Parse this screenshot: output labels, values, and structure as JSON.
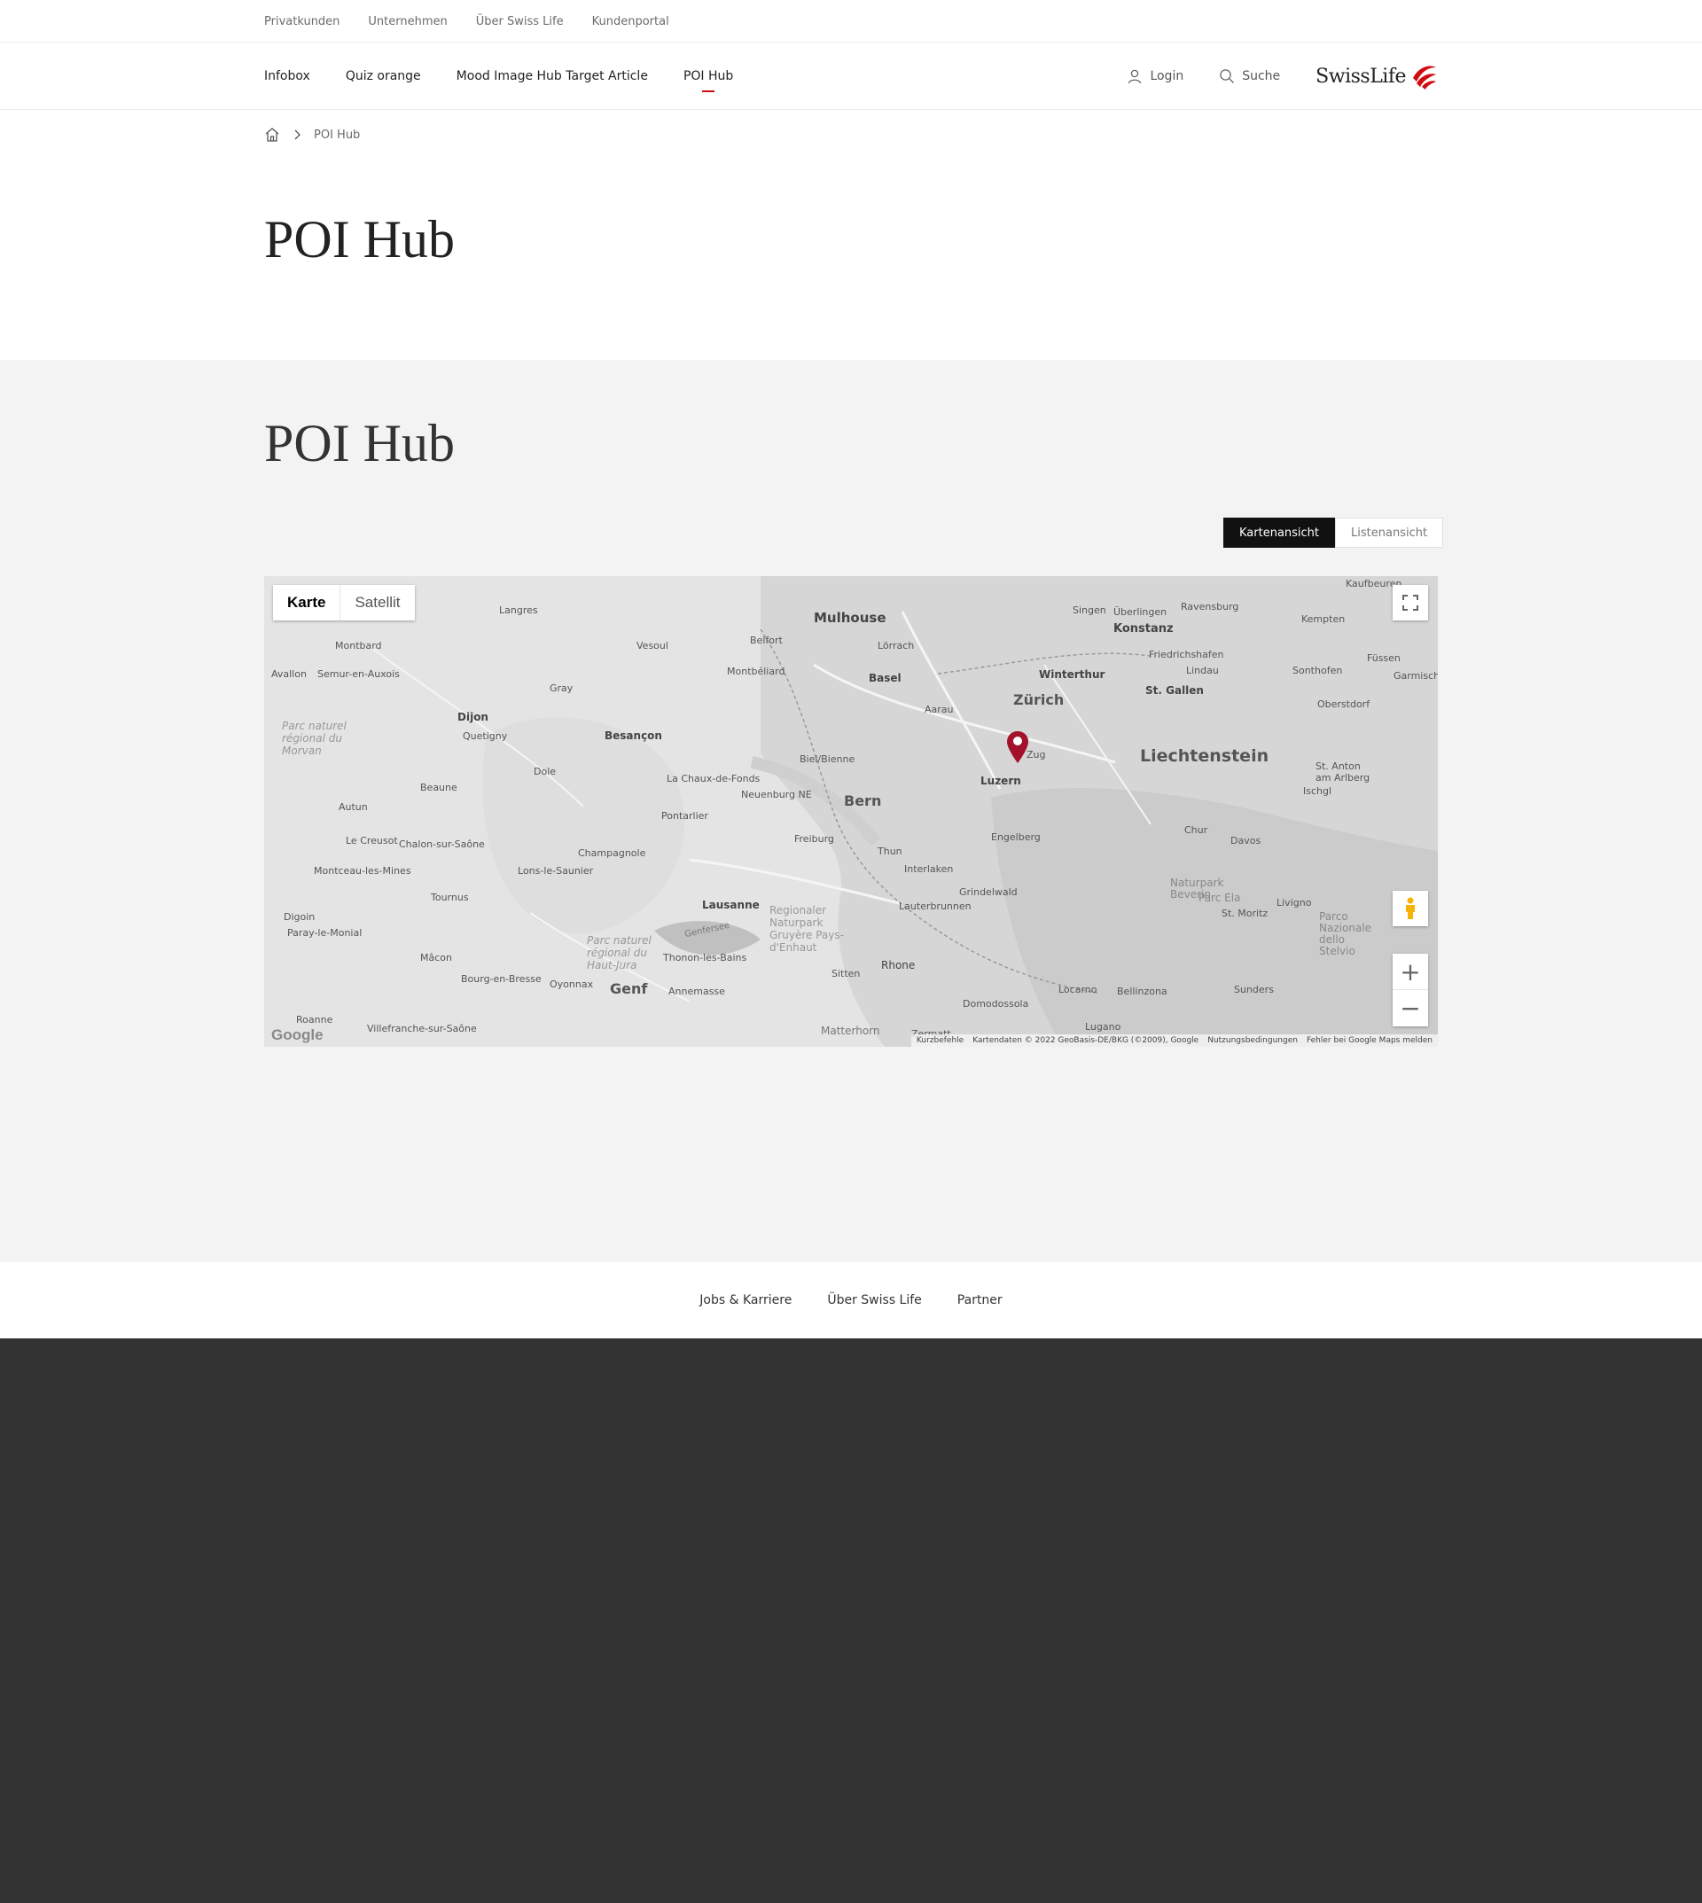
{
  "meta_nav": {
    "items": [
      "Privatkunden",
      "Unternehmen",
      "Über Swiss Life",
      "Kundenportal"
    ]
  },
  "main_nav": {
    "items": [
      "Infobox",
      "Quiz orange",
      "Mood Image Hub Target Article",
      "POI Hub"
    ],
    "active": "POI Hub",
    "login_label": "Login",
    "search_label": "Suche",
    "logo_text": "SwissLife",
    "accent_color": "#d20a11"
  },
  "breadcrumb": {
    "current": "POI Hub"
  },
  "page": {
    "title": "POI Hub"
  },
  "poi_section": {
    "title": "POI Hub",
    "view_toggle": {
      "map_label": "Kartenansicht",
      "list_label": "Listenansicht",
      "selected": "Kartenansicht"
    }
  },
  "map": {
    "type_map_label": "Karte",
    "type_satellite_label": "Satellit",
    "selected_type": "Karte",
    "place_labels": [
      "Mulhouse",
      "Langres",
      "Montbard",
      "Vesoul",
      "Belfort",
      "Lörrach",
      "Singen",
      "Überlingen",
      "Ravensburg",
      "Kempten",
      "Konstanz",
      "Kaufbeuren",
      "Avallon",
      "Semur-en-Auxois",
      "Montbéliard",
      "Basel",
      "Winterthur",
      "Friedrichshafen",
      "Lindau",
      "Sonthofen",
      "Füssen",
      "Garmisch",
      "Dijon",
      "Gray",
      "Aarau",
      "Zürich",
      "St. Gallen",
      "Oberstdorf",
      "Quetigny",
      "Besançon",
      "Liechtenstein",
      "Zug",
      "Biel/Bienne",
      "La Chaux-de-Fonds",
      "Dole",
      "Beaune",
      "Neuenburg NE",
      "Luzern",
      "St. Anton am Arlberg",
      "Ischgl",
      "Bern",
      "Autun",
      "Pontarlier",
      "Le Creusot",
      "Chalon-sur-Saône",
      "Champagnole",
      "Freiburg",
      "Engelberg",
      "Chur",
      "Davos",
      "Thun",
      "Montceau-les-Mines",
      "Lons-le-Saunier",
      "Interlaken",
      "Tournus",
      "Grindelwald",
      "Naturpark Beverin",
      "Parc Ela",
      "Lausanne",
      "Lauterbrunnen",
      "Livigno",
      "Digoin",
      "Paray-le-Monial",
      "Genfersee",
      "St. Moritz",
      "Parco Nazionale dello Stelvio",
      "Mâcon",
      "Thonon-les-Bains",
      "Rhone",
      "Bourg-en-Bresse",
      "Oyonnax",
      "Sitten",
      "Genf",
      "Annemasse",
      "Locarno",
      "Bellinzona",
      "Sunders",
      "Domodossola",
      "Roanne",
      "Villefranche-sur-Saône",
      "Matterhorn",
      "Zermatt",
      "Lugano",
      "Parc naturel régional du Morvan",
      "Parc naturel régional du Haut-Jura",
      "Regionaler Naturpark Gruyère Pays-d'Enhaut"
    ],
    "attribution": [
      "Kurzbefehle",
      "Kartendaten © 2022 GeoBasis-DE/BKG (©2009), Google",
      "Nutzungsbedingungen",
      "Fehler bei Google Maps melden"
    ],
    "google_logo": "Google",
    "marker_color": "#a3122a"
  },
  "footer": {
    "items": [
      "Jobs & Karriere",
      "Über Swiss Life",
      "Partner"
    ]
  },
  "icons": [
    "home-icon",
    "chevron-right-icon",
    "user-icon",
    "search-icon",
    "swisslife-logo-icon",
    "fullscreen-icon",
    "pegman-icon",
    "zoom-in-icon",
    "zoom-out-icon",
    "map-marker-icon"
  ]
}
